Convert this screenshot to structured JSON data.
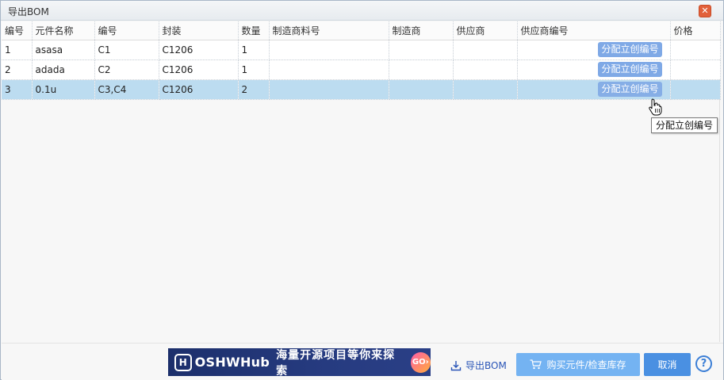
{
  "window": {
    "title": "导出BOM",
    "close_glyph": "✕"
  },
  "table": {
    "columns": [
      "编号",
      "元件名称",
      "编号",
      "封装",
      "数量",
      "制造商料号",
      "制造商",
      "供应商",
      "供应商编号",
      "价格"
    ],
    "rows": [
      {
        "index": "1",
        "name": "asasa",
        "designator": "C1",
        "package": "C1206",
        "qty": "1",
        "mfr_part": "",
        "mfr": "",
        "supplier": "",
        "supplier_no_button": "分配立创编号",
        "price": ""
      },
      {
        "index": "2",
        "name": "adada",
        "designator": "C2",
        "package": "C1206",
        "qty": "1",
        "mfr_part": "",
        "mfr": "",
        "supplier": "",
        "supplier_no_button": "分配立创编号",
        "price": ""
      },
      {
        "index": "3",
        "name": "0.1u",
        "designator": "C3,C4",
        "package": "C1206",
        "qty": "2",
        "mfr_part": "",
        "mfr": "",
        "supplier": "",
        "supplier_no_button": "分配立创编号",
        "price": ""
      }
    ],
    "selected_row": 3
  },
  "tooltip": {
    "text": "分配立创编号"
  },
  "footer": {
    "banner": {
      "logo_glyph": "H",
      "brand": "OSHWHub",
      "slogan": "海量开源项目等你来探索",
      "go_label": "GO›"
    },
    "export_label": "导出BOM",
    "buy_label": "购买元件/检查库存",
    "cancel_label": "取消",
    "help_glyph": "?"
  },
  "colors": {
    "selected_row": "#bcdcf0",
    "assign_button": "#7fa9e6",
    "cancel_button": "#4a90e2",
    "buy_button": "#74b3f2",
    "close_button": "#e2603a"
  },
  "icons": [
    "close-icon",
    "download-icon",
    "cart-icon",
    "help-icon",
    "hand-cursor-icon",
    "oshwhub-logo-icon"
  ]
}
